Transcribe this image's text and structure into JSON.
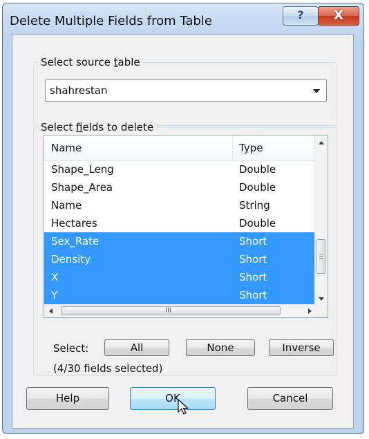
{
  "window": {
    "title": "Delete Multiple Fields from Table",
    "help_glyph": "?",
    "close_glyph": "X"
  },
  "source": {
    "label_pre": "Select source ",
    "label_accel": "t",
    "label_post": "able",
    "value": "shahrestan"
  },
  "fields": {
    "label_pre": "Select ",
    "label_accel": "f",
    "label_post": "ields to delete",
    "columns": [
      "Name",
      "Type"
    ],
    "rows": [
      {
        "name": "Shape_Leng",
        "type": "Double",
        "selected": false
      },
      {
        "name": "Shape_Area",
        "type": "Double",
        "selected": false
      },
      {
        "name": "Name",
        "type": "String",
        "selected": false
      },
      {
        "name": "Hectares",
        "type": "Double",
        "selected": false
      },
      {
        "name": "Sex_Rate",
        "type": "Short",
        "selected": true
      },
      {
        "name": "Density",
        "type": "Short",
        "selected": true
      },
      {
        "name": "X",
        "type": "Short",
        "selected": true
      },
      {
        "name": "Y",
        "type": "Short",
        "selected": true
      }
    ],
    "scroll_grip": "III"
  },
  "selection": {
    "label": "Select:",
    "all": "All",
    "none": "None",
    "inverse": "Inverse",
    "count_text": "(4/30 fields selected)"
  },
  "footer": {
    "help": "Help",
    "ok": "OK",
    "cancel": "Cancel"
  },
  "colors": {
    "selection": "#3399ff",
    "title_bar": "#c7dcf2",
    "close_button": "#c53a20"
  }
}
